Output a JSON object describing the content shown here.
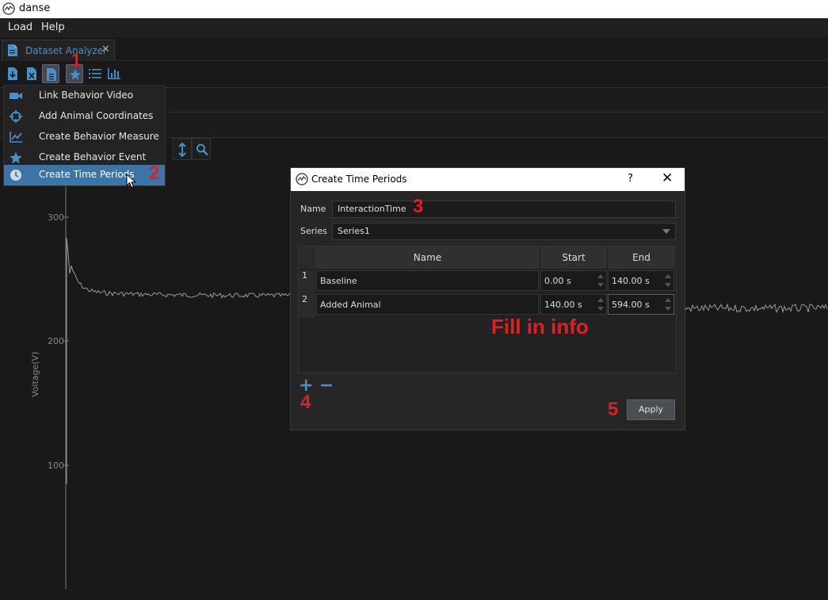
{
  "window": {
    "title": "danse"
  },
  "menu": {
    "items": [
      "Load",
      "Help"
    ]
  },
  "tab": {
    "label": "Dataset Analyzer",
    "close": "✕"
  },
  "plot": {
    "yaxis_label": "Voltage(V)",
    "yticks": [
      "300",
      "200",
      "100"
    ]
  },
  "dropdown": {
    "items": [
      {
        "label": "Link Behavior Video",
        "icon": "video-camera-icon"
      },
      {
        "label": "Add Animal Coordinates",
        "icon": "crosshair-icon"
      },
      {
        "label": "Create Behavior Measure",
        "icon": "line-chart-icon"
      },
      {
        "label": "Create Behavior Event",
        "icon": "star-icon"
      },
      {
        "label": "Create Time Periods",
        "icon": "clock-icon",
        "selected": true
      }
    ]
  },
  "annotations": {
    "step1": "1",
    "step2": "2",
    "step3": "3",
    "step4": "4",
    "step5": "5",
    "fill_info": "Fill in info"
  },
  "dialog": {
    "title": "Create Time Periods",
    "help": "?",
    "close": "✕",
    "name_label": "Name",
    "name_value": "InteractionTime",
    "series_label": "Series",
    "series_value": "Series1",
    "table": {
      "headers": [
        "Name",
        "Start",
        "End"
      ],
      "rows": [
        {
          "num": "1",
          "name": "Baseline",
          "start": "0.00 s",
          "end": "140.00 s"
        },
        {
          "num": "2",
          "name": "Added Animal",
          "start": "140.00 s",
          "end": "594.00 s"
        }
      ]
    },
    "add_label": "+",
    "remove_label": "−",
    "apply_label": "Apply"
  },
  "colors": {
    "accent": "#3d74a8",
    "annotation": "#e02020",
    "trace": "#9a9a9a"
  }
}
